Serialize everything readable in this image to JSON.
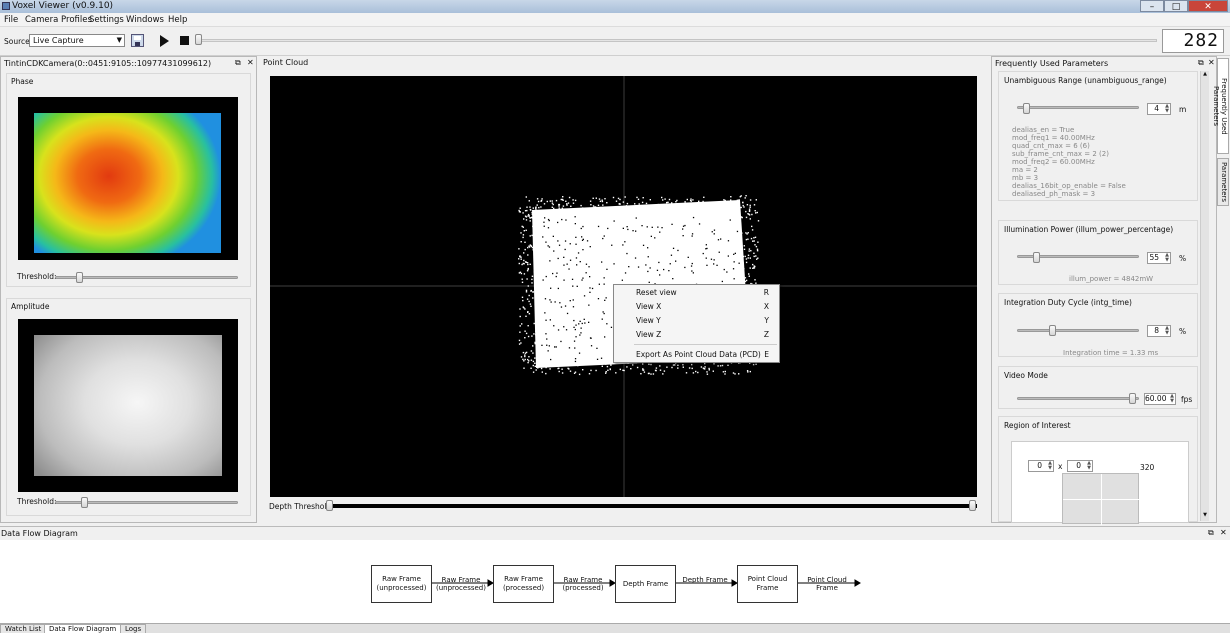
{
  "window": {
    "title": "Voxel Viewer (v0.9.10)"
  },
  "menu": [
    "File",
    "Camera Profiles",
    "Settings",
    "Windows",
    "Help"
  ],
  "toolbar": {
    "source_label": "Source:",
    "source_value": "Live Capture",
    "counter": "282"
  },
  "left_panel": {
    "title": "TintinCDKCamera(0::0451:9105::10977431099612)",
    "phase": {
      "title": "Phase",
      "threshold_label": "Threshold:",
      "threshold_level": 0.12
    },
    "amplitude": {
      "title": "Amplitude",
      "threshold_label": "Threshold:",
      "threshold_level": 0.15
    }
  },
  "point_cloud": {
    "title": "Point Cloud",
    "depth_threshold_label": "Depth Threshold:",
    "context_menu": [
      {
        "label": "Reset view",
        "key": "R"
      },
      {
        "label": "View X",
        "key": "X"
      },
      {
        "label": "View Y",
        "key": "Y"
      },
      {
        "label": "View Z",
        "key": "Z"
      },
      {
        "label": "Export As Point Cloud Data (PCD)",
        "key": "E"
      }
    ]
  },
  "right_panel": {
    "title": "Frequently Used Parameters",
    "side_tabs": [
      "Frequently Used Parameters",
      "Parameters"
    ],
    "unambiguous": {
      "title": "Unambiguous Range (unambiguous_range)",
      "value": "4",
      "unit": "m",
      "level": 0.05,
      "info": [
        "dealias_en = True",
        "mod_freq1 = 40.00MHz",
        "quad_cnt_max = 6 (6)",
        "sub_frame_cnt_max = 2 (2)",
        "mod_freq2 = 60.00MHz",
        "ma = 2",
        "mb = 3",
        "dealias_16bit_op_enable = False",
        "dealiased_ph_mask = 3"
      ]
    },
    "illumination": {
      "title": "Illumination Power (illum_power_percentage)",
      "value": "55",
      "unit": "%",
      "level": 0.14,
      "info": "illum_power = 4842mW"
    },
    "integration": {
      "title": "Integration Duty Cycle (intg_time)",
      "value": "8",
      "unit": "%",
      "level": 0.28,
      "info": "Integration time = 1.33 ms"
    },
    "video": {
      "title": "Video Mode",
      "value": "60.00",
      "unit": "fps",
      "level": 0.97
    },
    "roi": {
      "title": "Region of Interest",
      "x": "0",
      "sep": "x",
      "y": "0",
      "max": "320"
    }
  },
  "dataflow": {
    "title": "Data Flow Diagram",
    "nodes": [
      "Raw Frame (unprocessed)",
      "Raw Frame (processed)",
      "Depth Frame",
      "Point Cloud Frame"
    ],
    "edges": [
      "Raw Frame (unprocessed)",
      "Raw Frame (processed)",
      "Depth Frame",
      "Point Cloud Frame"
    ]
  },
  "bottom_tabs": [
    "Watch List",
    "Data Flow Diagram",
    "Logs"
  ]
}
